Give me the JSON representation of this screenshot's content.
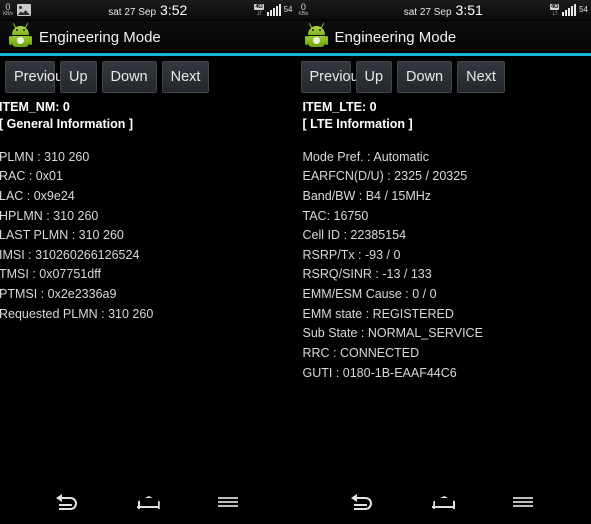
{
  "panels": [
    {
      "status": {
        "netspeed_value": "0",
        "netspeed_unit": "KB/s",
        "gallery_icon": "gallery-icon",
        "date": "sat 27 Sep",
        "time": "3:52",
        "network_badge": "4G",
        "data_arrows": "↓↑",
        "signal_icon": "signal-bars-icon",
        "battery": "54"
      },
      "appbar": {
        "icon": "android-robot-icon",
        "title": "Engineering Mode"
      },
      "buttons": [
        {
          "name": "previous",
          "label": "Previous",
          "wrap": true
        },
        {
          "name": "up",
          "label": "Up",
          "wrap": false
        },
        {
          "name": "down",
          "label": "Down",
          "wrap": false
        },
        {
          "name": "next",
          "label": "Next",
          "wrap": false
        }
      ],
      "info": {
        "item_header": "ITEM_NM: 0",
        "section_header": "[ General Information ]",
        "rows": [
          "PLMN : 310 260",
          "RAC : 0x01",
          "LAC : 0x9e24",
          "HPLMN : 310 260",
          "LAST PLMN : 310 260",
          "IMSI  : 310260266126524",
          "TMSI : 0x07751dff",
          "PTMSI : 0x2e2336a9",
          "Requested PLMN : 310 260"
        ]
      }
    },
    {
      "status": {
        "netspeed_value": "0",
        "netspeed_unit": "KB/s",
        "gallery_icon": null,
        "date": "sat 27 Sep",
        "time": "3:51",
        "network_badge": "4G",
        "data_arrows": "↓↑",
        "signal_icon": "signal-bars-icon",
        "battery": "54"
      },
      "appbar": {
        "icon": "android-robot-icon",
        "title": "Engineering Mode"
      },
      "buttons": [
        {
          "name": "previous",
          "label": "Previous",
          "wrap": true
        },
        {
          "name": "up",
          "label": "Up",
          "wrap": false
        },
        {
          "name": "down",
          "label": "Down",
          "wrap": false
        },
        {
          "name": "next",
          "label": "Next",
          "wrap": false
        }
      ],
      "info": {
        "item_header": "ITEM_LTE: 0",
        "section_header": "[ LTE Information ]",
        "rows": [
          "Mode Pref. : Automatic",
          "EARFCN(D/U) :  2325 / 20325",
          "Band/BW :  B4 / 15MHz",
          "TAC:  16750",
          "Cell ID :  22385154",
          "RSRP/Tx :  -93 / 0",
          "RSRQ/SINR :  -13 / 133",
          "EMM/ESM Cause :  0 / 0",
          "EMM state :  REGISTERED",
          "Sub State :  NORMAL_SERVICE",
          "RRC :  CONNECTED",
          "GUTI :  0180-1B-EAAF44C6"
        ]
      }
    }
  ],
  "sysnav": {
    "items": [
      {
        "name": "back-icon"
      },
      {
        "name": "home-icon"
      },
      {
        "name": "recents-menu-icon"
      }
    ]
  },
  "colors": {
    "accent": "#16b7d8",
    "background": "#000000",
    "button_face": "#2b2e33",
    "text": "#d9d9d9"
  }
}
